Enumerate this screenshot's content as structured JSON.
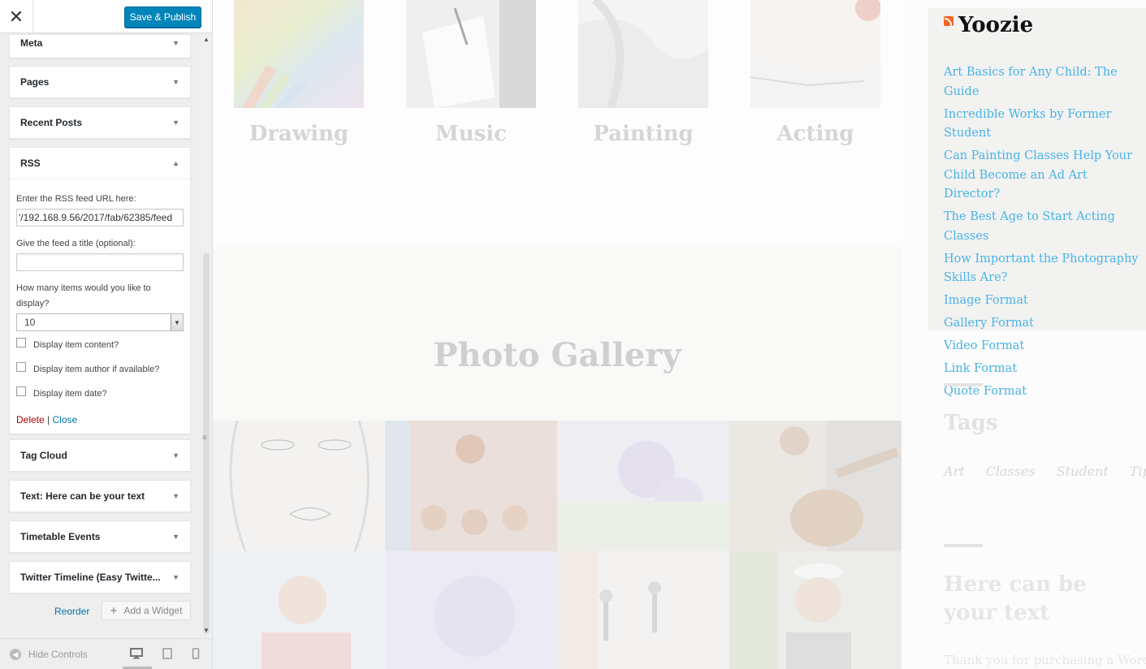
{
  "header": {
    "close_symbol": "✕",
    "save_label": "Save & Publish"
  },
  "widgets": [
    {
      "name": "Meta",
      "state": "collapsed"
    },
    {
      "name": "Pages",
      "state": "collapsed"
    },
    {
      "name": "Recent Posts",
      "state": "collapsed"
    },
    {
      "name": "RSS",
      "state": "expanded"
    },
    {
      "name": "Tag Cloud",
      "state": "collapsed"
    },
    {
      "name": "Text:",
      "subtitle": "Here can be your text",
      "state": "collapsed"
    },
    {
      "name": "Timetable Events",
      "state": "collapsed"
    },
    {
      "name": "Twitter Timeline (Easy Twitte...",
      "state": "collapsed"
    }
  ],
  "rss_form": {
    "url_label": "Enter the RSS feed URL here:",
    "url_value": "'/192.168.9.56/2017/fab/62385/feed",
    "title_label": "Give the feed a title (optional):",
    "title_value": "",
    "items_label": "How many items would you like to display?",
    "items_value": "10",
    "checkboxes": [
      {
        "label": "Display item content?",
        "checked": false
      },
      {
        "label": "Display item author if available?",
        "checked": false
      },
      {
        "label": "Display item date?",
        "checked": false
      }
    ],
    "delete_label": "Delete",
    "separator": "|",
    "close_label": "Close"
  },
  "actions": {
    "reorder_label": "Reorder",
    "add_widget_label": "Add a Widget",
    "add_symbol": "+"
  },
  "footer": {
    "hide_controls_label": "Hide Controls"
  },
  "preview": {
    "classes": [
      "Drawing",
      "Music",
      "Painting",
      "Acting"
    ],
    "gallery_title": "Photo Gallery",
    "rss_widget": {
      "title": "Yoozie",
      "items": [
        "Art Basics for Any Child: The Guide",
        "Incredible Works by Former Student",
        "Can Painting Classes Help Your Child Become an Ad Art Director?",
        "The Best Age to Start Acting Classes",
        "How Important the Photography Skills Are?",
        "Image Format",
        "Gallery Format",
        "Video Format",
        "Link Format",
        "Quote Format"
      ]
    },
    "tags_title": "Tags",
    "tags": [
      "Art",
      "Classes",
      "Student",
      "Tips"
    ],
    "text_widget_title": "Here can be your text",
    "text_widget_body": "Thank you for purchasing a WordPress"
  },
  "colors": {
    "primary_button": "#0085ba",
    "link": "#0073aa",
    "delete": "#a00000",
    "rss_link": "#49b3e5"
  }
}
